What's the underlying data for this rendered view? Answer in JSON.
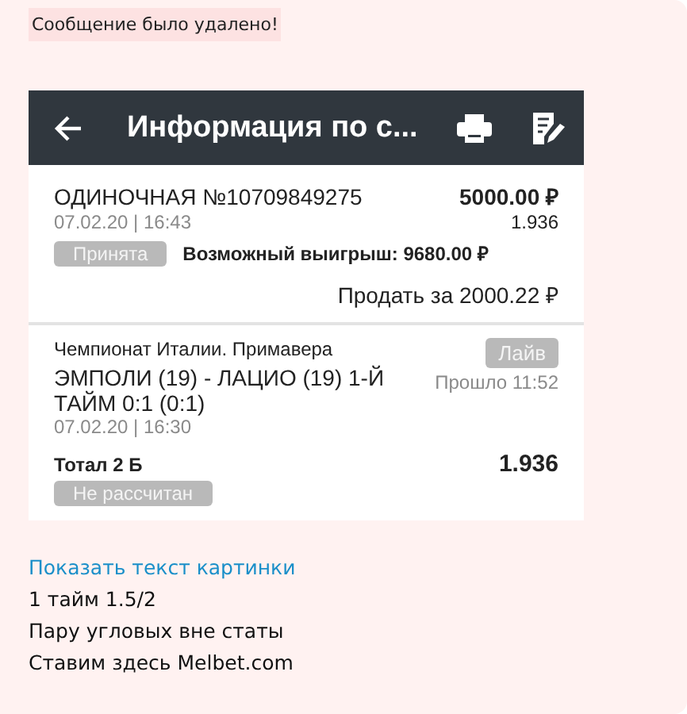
{
  "notice": "Сообщение было удалено!",
  "screenshot": {
    "title": "Информация по с...",
    "bet": {
      "type": "ОДИНОЧНАЯ №10709849275",
      "amount": "5000.00 ₽",
      "datetime": "07.02.20 | 16:43",
      "coef": "1.936",
      "status": "Принята",
      "possible_win": "Возможный выигрыш: 9680.00 ₽",
      "sell": "Продать за 2000.22 ₽"
    },
    "event": {
      "league": "Чемпионат Италии. Примавера",
      "live_badge": "Лайв",
      "match": "ЭМПОЛИ (19) - ЛАЦИО (19) 1-Й ТАЙМ 0:1 (0:1)",
      "elapsed": "Прошло 11:52",
      "datetime": "07.02.20 | 16:30",
      "market": "Тотал 2 Б",
      "coef": "1.936",
      "status": "Не рассчитан"
    }
  },
  "show_text_link": "Показать текст картинки",
  "lines": [
    "1 тайм 1.5/2",
    "Пару угловых вне статы",
    "Ставим здесь Melbet.com"
  ]
}
